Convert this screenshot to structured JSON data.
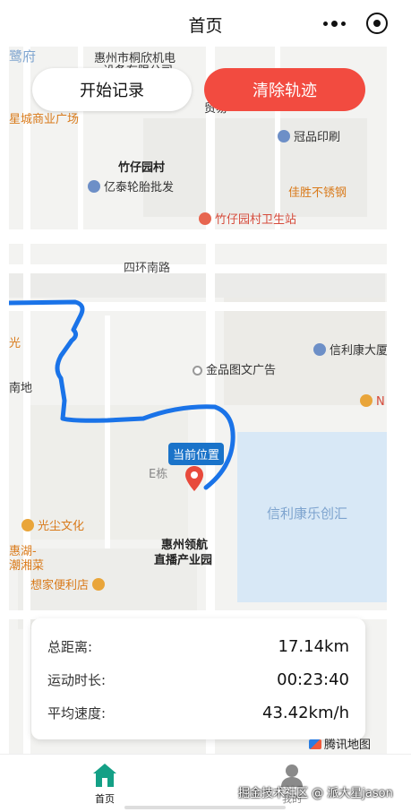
{
  "navbar": {
    "title": "首页"
  },
  "buttons": {
    "start": "开始记录",
    "clear": "清除轨迹"
  },
  "map": {
    "labels": {
      "a": "惠州市桐欣机电",
      "b": "设备有限公司",
      "c": "鹭府",
      "d": "星城商业广场",
      "e": "贸易",
      "f": "冠品印刷",
      "g": "竹仔园村",
      "h": "亿泰轮胎批发",
      "i": "佳胜不锈钢",
      "j": "竹仔园村卫生站",
      "k": "四环南路",
      "l": "光",
      "m": "信利康大厦",
      "n": "金品图文广告",
      "o": "南地",
      "p": "N",
      "q": "E栋",
      "r": "信利康乐创汇",
      "s": "光尘文化",
      "t": "惠湖-",
      "u": "潮湘菜",
      "v": "惠州领航",
      "w": "直播产业园",
      "x": "想家便利店"
    },
    "location_label": "当前位置",
    "provider": "腾讯地图"
  },
  "stats": {
    "distance_label": "总距离:",
    "distance_value": "17.14km",
    "duration_label": "运动时长:",
    "duration_value": "00:23:40",
    "speed_label": "平均速度:",
    "speed_value": "43.42km/h"
  },
  "tabbar": {
    "home": "首页",
    "mine": "我的"
  },
  "credit": "掘金技术社区 @ 派大星jason",
  "colors": {
    "accent": "#f24b40",
    "track": "#1a73e8",
    "tab_active": "#14a086"
  }
}
